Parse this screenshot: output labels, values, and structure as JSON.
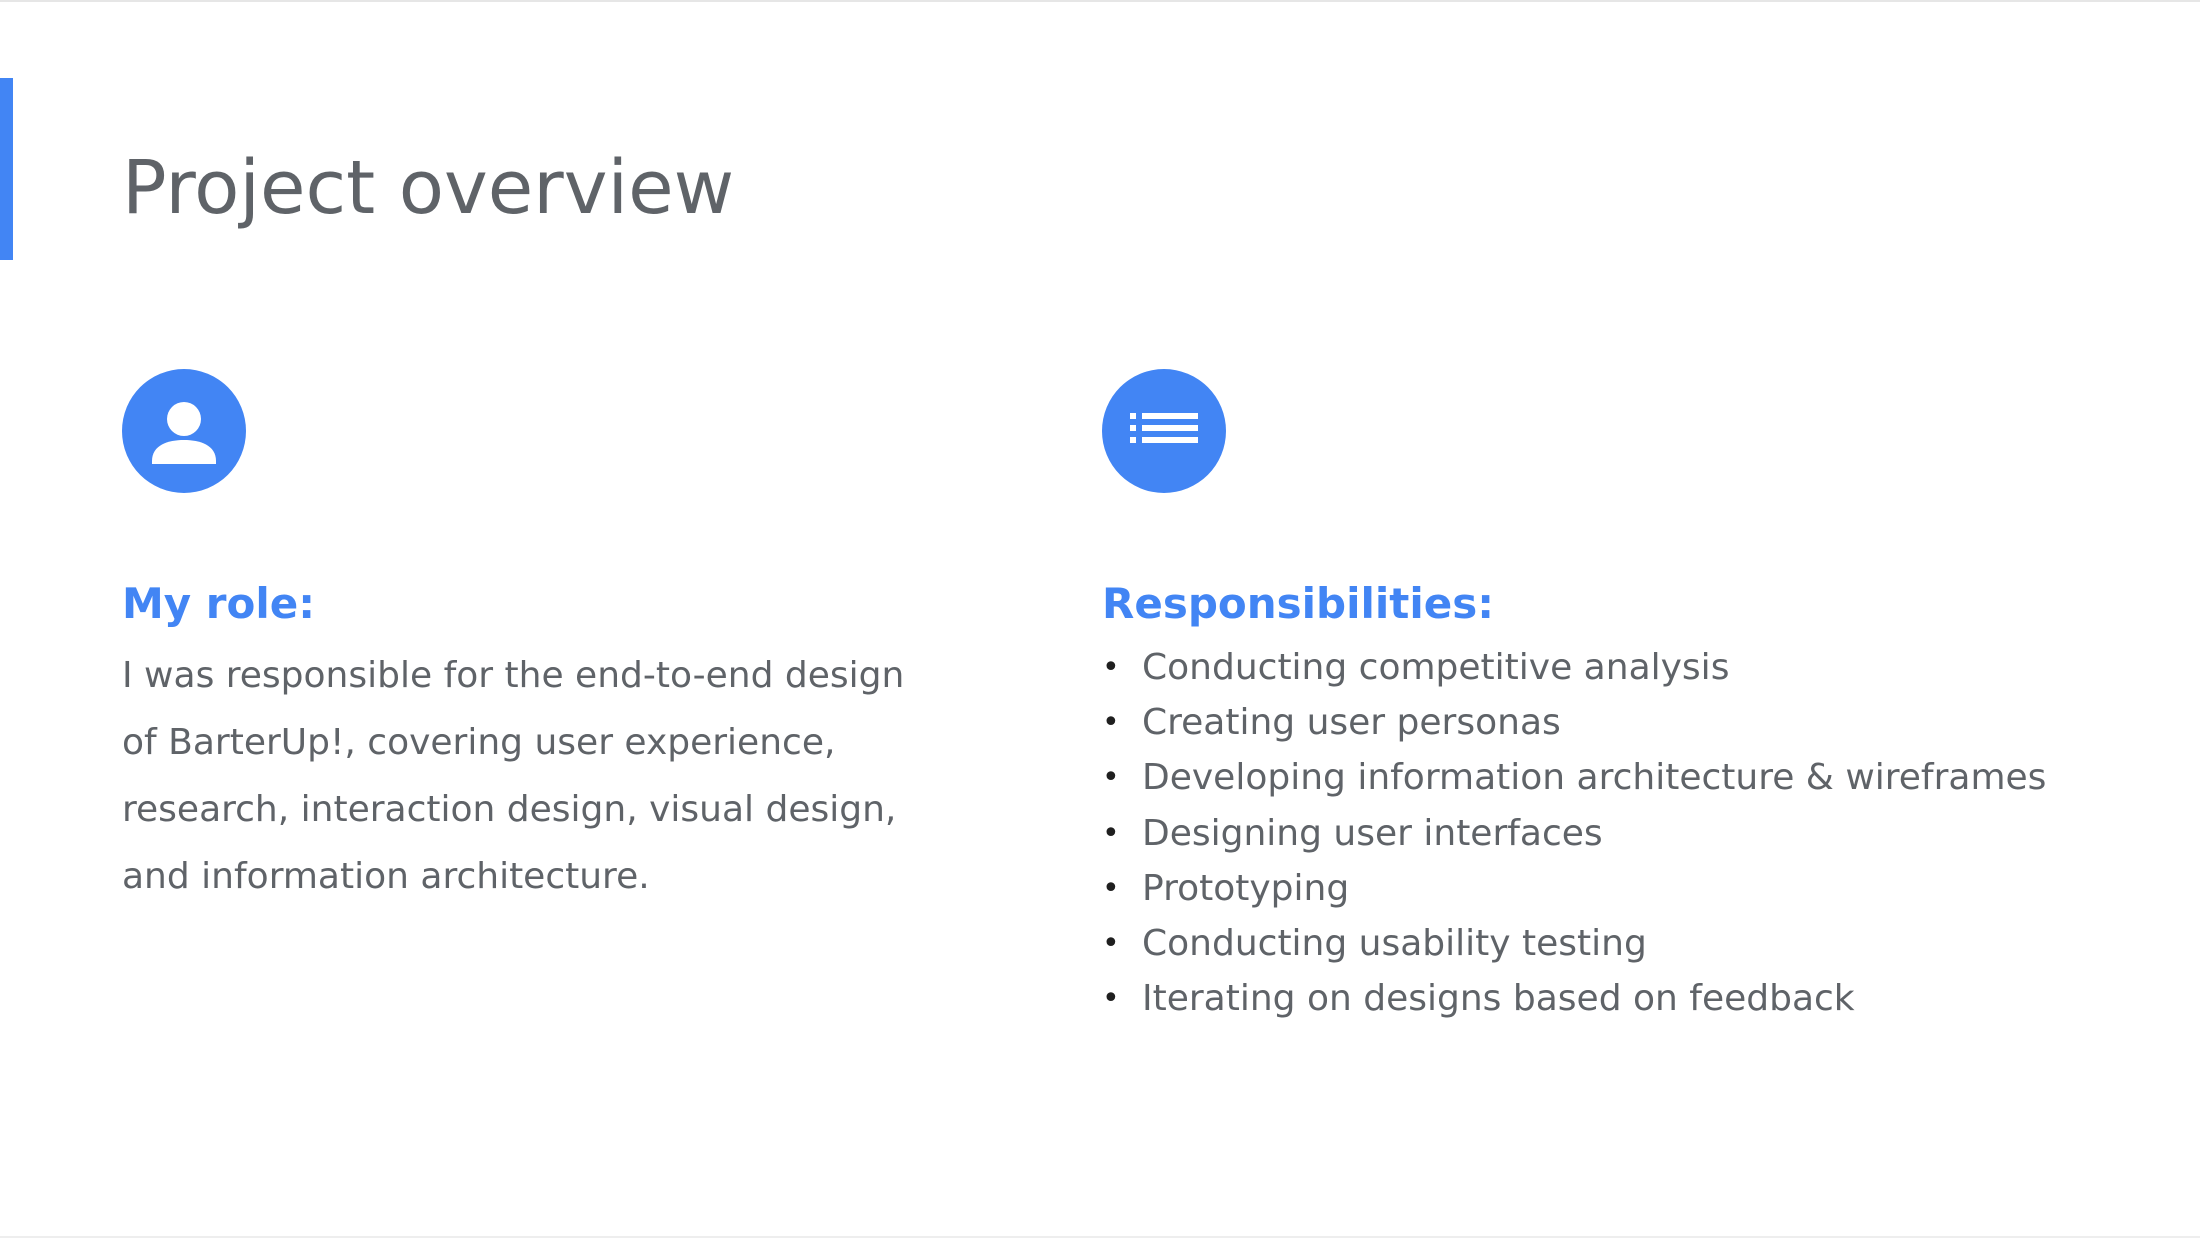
{
  "title": "Project overview",
  "colors": {
    "accent": "#4285f4",
    "text": "#5f6368"
  },
  "role": {
    "icon": "person-icon",
    "heading": "My role:",
    "body": "I was responsible for the end-to-end design of BarterUp!, covering user experience, research, interaction design, visual design, and information architecture."
  },
  "responsibilities": {
    "icon": "list-icon",
    "heading": "Responsibilities:",
    "bullet": "•",
    "items": [
      "Conducting competitive analysis",
      "Creating user personas",
      "Developing information architecture & wireframes",
      "Designing user interfaces",
      "Prototyping",
      "Conducting usability testing",
      "Iterating on designs based on feedback"
    ]
  }
}
